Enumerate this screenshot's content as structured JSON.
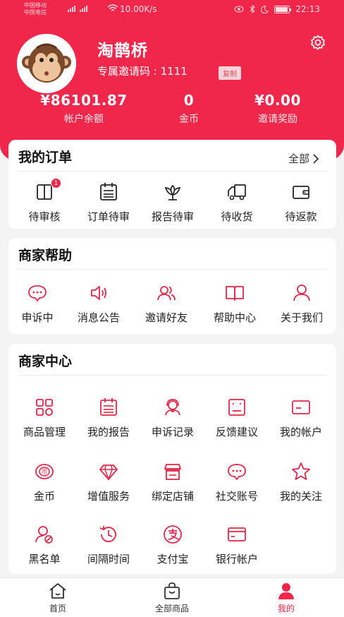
{
  "status_bar": {
    "carrier1": "中国移动",
    "carrier2": "中国电信",
    "speed": "10.00K/s",
    "time": "22:13",
    "battery_level": 0.9
  },
  "profile": {
    "name": "淘鹊桥",
    "invite_label": "专属邀请码 : 1111",
    "copy_label": "复制"
  },
  "stats": [
    {
      "value": "¥86101.87",
      "label": "帐户余额"
    },
    {
      "value": "0",
      "label": "金币"
    },
    {
      "value": "¥0.00",
      "label": "邀请奖励"
    }
  ],
  "orders": {
    "title": "我的订单",
    "more_label": "全部",
    "items": [
      {
        "label": "待审核",
        "icon": "book-icon",
        "badge": "1"
      },
      {
        "label": "订单待审",
        "icon": "calendar-list-icon"
      },
      {
        "label": "报告待审",
        "icon": "lotus-icon"
      },
      {
        "label": "待收货",
        "icon": "truck-icon"
      },
      {
        "label": "待返款",
        "icon": "wallet-icon"
      }
    ]
  },
  "help": {
    "title": "商家帮助",
    "items": [
      {
        "label": "申诉中",
        "icon": "chat-bubble-icon"
      },
      {
        "label": "消息公告",
        "icon": "speaker-icon"
      },
      {
        "label": "邀请好友",
        "icon": "users-icon"
      },
      {
        "label": "帮助中心",
        "icon": "open-book-icon"
      },
      {
        "label": "关于我们",
        "icon": "user-icon"
      }
    ]
  },
  "center": {
    "title": "商家中心",
    "items": [
      {
        "label": "商品管理",
        "icon": "grid-apps-icon"
      },
      {
        "label": "我的报告",
        "icon": "report-icon"
      },
      {
        "label": "申诉记录",
        "icon": "agent-icon"
      },
      {
        "label": "反馈建议",
        "icon": "feedback-icon"
      },
      {
        "label": "我的帐户",
        "icon": "card-icon"
      },
      {
        "label": "金币",
        "icon": "coin-icon"
      },
      {
        "label": "增值服务",
        "icon": "diamond-icon"
      },
      {
        "label": "绑定店铺",
        "icon": "store-icon"
      },
      {
        "label": "社交账号",
        "icon": "chat-bubble-icon"
      },
      {
        "label": "我的关注",
        "icon": "star-icon"
      },
      {
        "label": "黑名单",
        "icon": "user-block-icon"
      },
      {
        "label": "间隔时间",
        "icon": "clock-history-icon"
      },
      {
        "label": "支付宝",
        "icon": "alipay-icon"
      },
      {
        "label": "银行帐户",
        "icon": "bank-card-icon"
      }
    ]
  },
  "tabbar": [
    {
      "label": "首页",
      "icon": "home-icon"
    },
    {
      "label": "全部商品",
      "icon": "shopping-bag-icon"
    },
    {
      "label": "我的",
      "icon": "profile-icon",
      "active": true
    }
  ],
  "colors": {
    "accent": "#f0264a",
    "background": "#f4f4f4"
  }
}
